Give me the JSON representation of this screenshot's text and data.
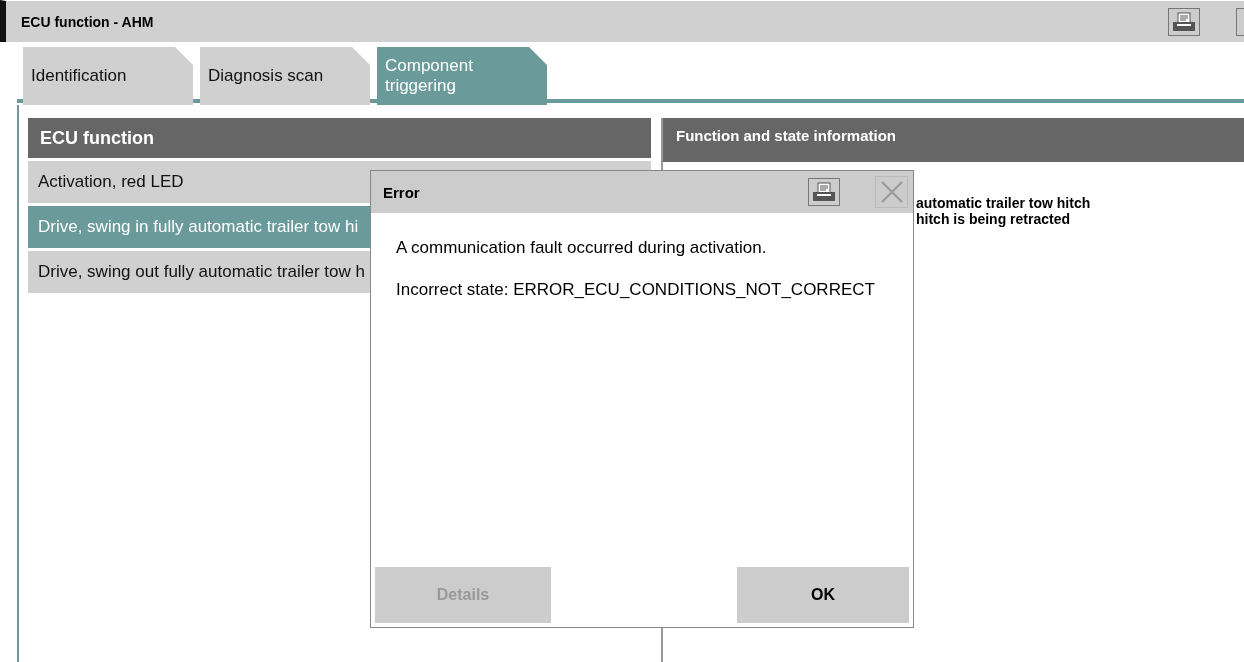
{
  "window": {
    "title": "ECU function - AHM"
  },
  "tabs": [
    {
      "label": "Identification",
      "selected": false
    },
    {
      "label": "Diagnosis scan",
      "selected": false
    },
    {
      "label": "Component triggering",
      "selected": true
    }
  ],
  "function_list": {
    "header": "ECU function",
    "items": [
      {
        "label": "Activation, red LED",
        "selected": false
      },
      {
        "label": "Drive, swing in fully automatic trailer tow hi",
        "selected": true
      },
      {
        "label": "Drive, swing out fully automatic trailer tow h",
        "selected": false
      }
    ]
  },
  "info_panel": {
    "header": "Function and state information",
    "lines": [
      "automatic trailer tow hitch",
      "hitch is being retracted"
    ]
  },
  "dialog": {
    "title": "Error",
    "messages": [
      "A communication fault occurred during activation.",
      "Incorrect state: ERROR_ECU_CONDITIONS_NOT_CORRECT"
    ],
    "buttons": [
      {
        "label": "Details",
        "disabled": true
      },
      {
        "label": "OK",
        "disabled": false
      }
    ]
  }
}
